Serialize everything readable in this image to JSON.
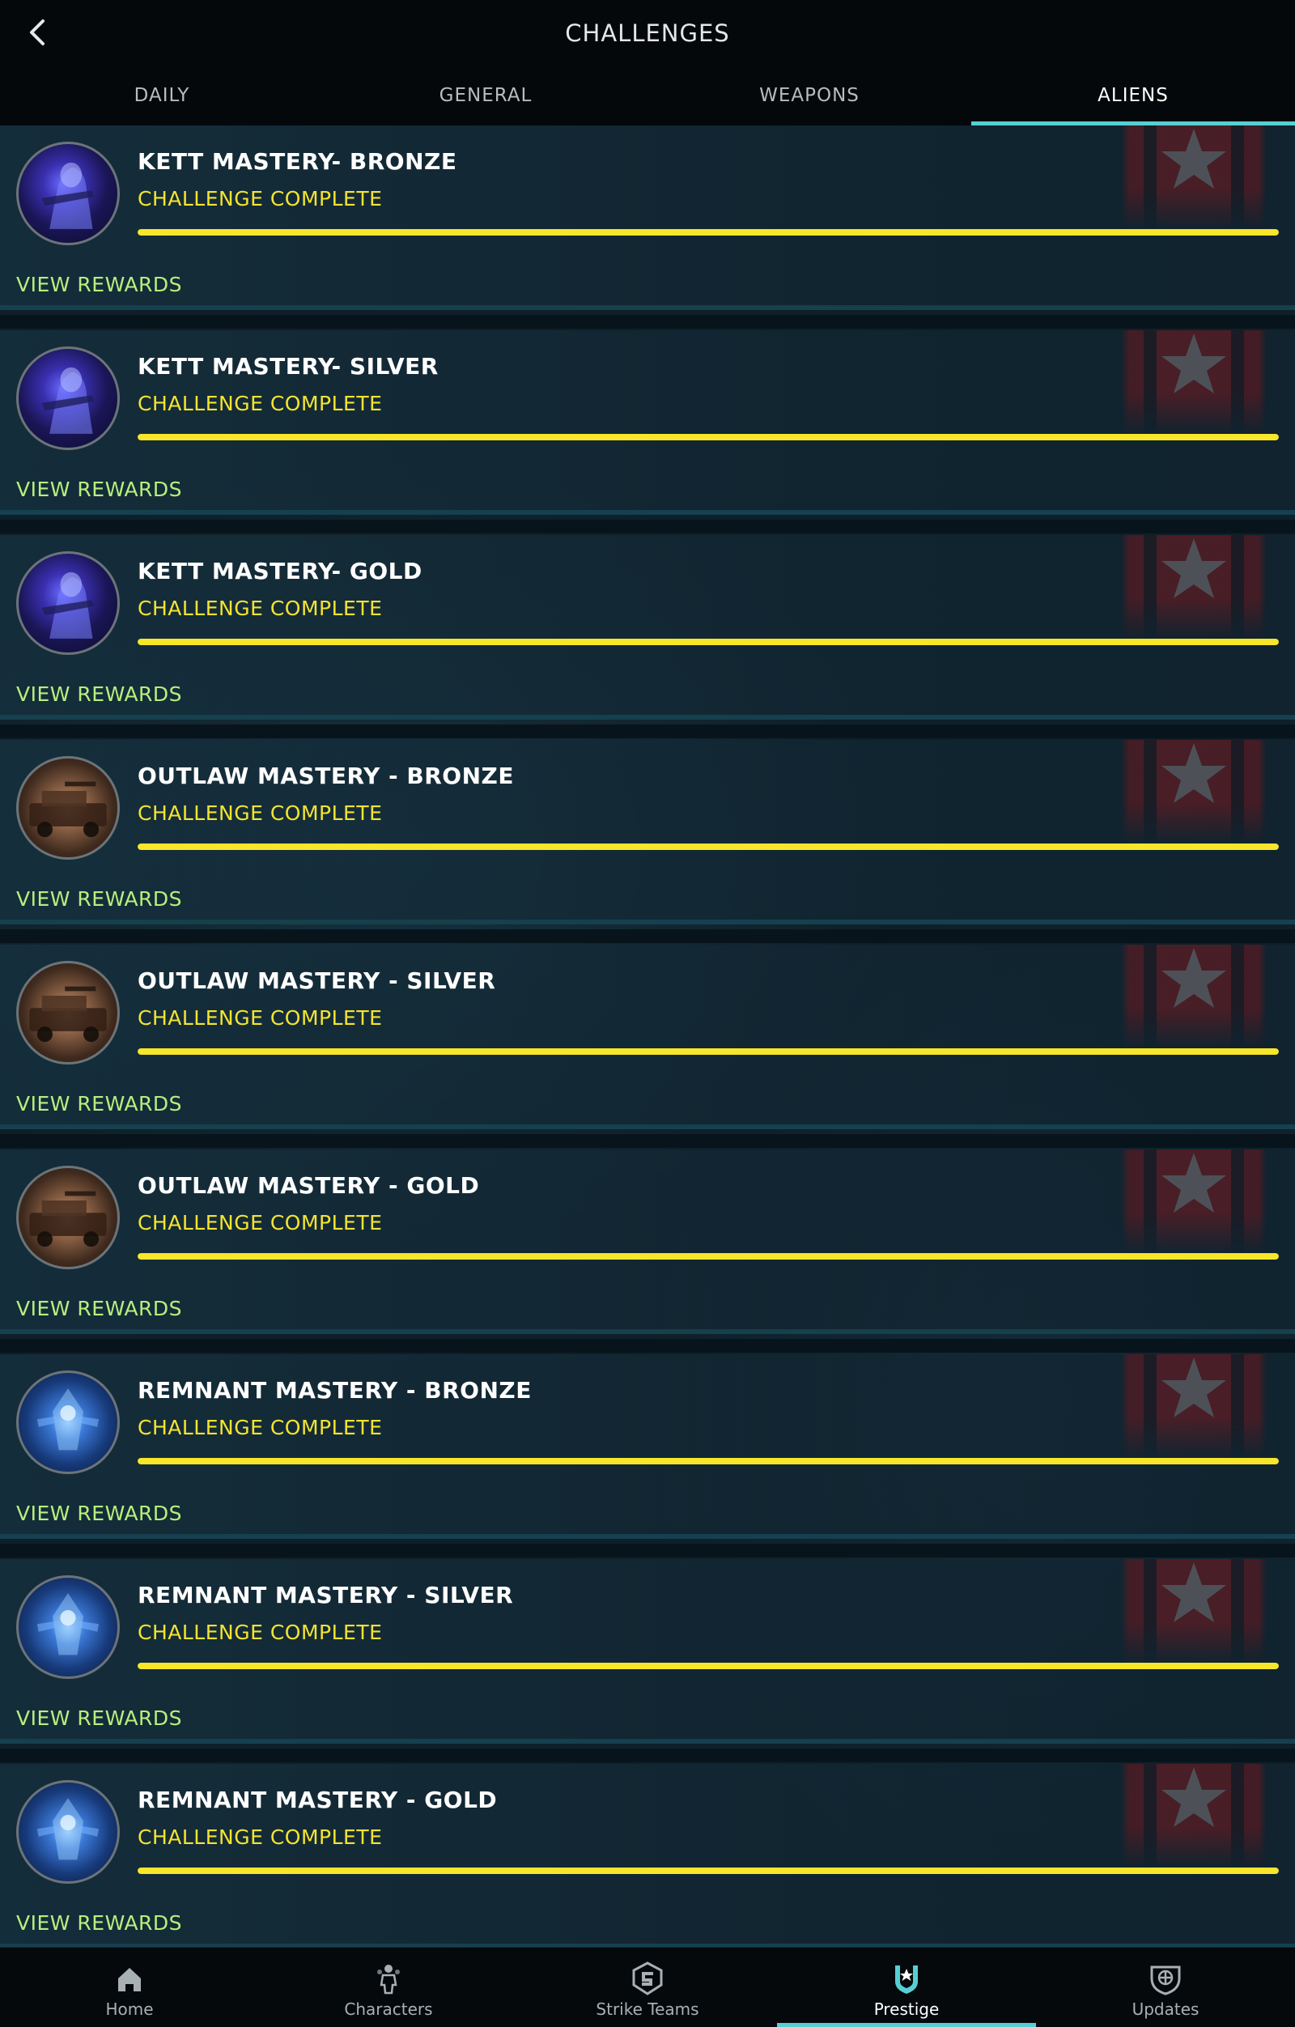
{
  "header": {
    "title": "CHALLENGES",
    "back_icon": "chevron-left-icon"
  },
  "tabs": [
    {
      "label": "DAILY",
      "active": false
    },
    {
      "label": "GENERAL",
      "active": false
    },
    {
      "label": "WEAPONS",
      "active": false
    },
    {
      "label": "ALIENS",
      "active": true
    }
  ],
  "challenges": [
    {
      "title": "KETT MASTERY- BRONZE",
      "status": "CHALLENGE COMPLETE",
      "progress": 1.0,
      "rewards_label": "VIEW REWARDS",
      "icon": "kett"
    },
    {
      "title": "KETT MASTERY- SILVER",
      "status": "CHALLENGE COMPLETE",
      "progress": 1.0,
      "rewards_label": "VIEW REWARDS",
      "icon": "kett"
    },
    {
      "title": "KETT MASTERY- GOLD",
      "status": "CHALLENGE COMPLETE",
      "progress": 1.0,
      "rewards_label": "VIEW REWARDS",
      "icon": "kett"
    },
    {
      "title": "OUTLAW MASTERY - BRONZE",
      "status": "CHALLENGE COMPLETE",
      "progress": 1.0,
      "rewards_label": "VIEW REWARDS",
      "icon": "outlaw"
    },
    {
      "title": "OUTLAW MASTERY - SILVER",
      "status": "CHALLENGE COMPLETE",
      "progress": 1.0,
      "rewards_label": "VIEW REWARDS",
      "icon": "outlaw"
    },
    {
      "title": "OUTLAW MASTERY - GOLD",
      "status": "CHALLENGE COMPLETE",
      "progress": 1.0,
      "rewards_label": "VIEW REWARDS",
      "icon": "outlaw"
    },
    {
      "title": "REMNANT MASTERY - BRONZE",
      "status": "CHALLENGE COMPLETE",
      "progress": 1.0,
      "rewards_label": "VIEW REWARDS",
      "icon": "remnant"
    },
    {
      "title": "REMNANT MASTERY - SILVER",
      "status": "CHALLENGE COMPLETE",
      "progress": 1.0,
      "rewards_label": "VIEW REWARDS",
      "icon": "remnant"
    },
    {
      "title": "REMNANT MASTERY - GOLD",
      "status": "CHALLENGE COMPLETE",
      "progress": 1.0,
      "rewards_label": "VIEW REWARDS",
      "icon": "remnant"
    }
  ],
  "colors": {
    "accent": "#56cfd3",
    "status": "#f3e431",
    "progress": "#f7e62a",
    "rewards": "#b7ef7e"
  },
  "bottom_nav": [
    {
      "label": "Home",
      "icon": "home-icon",
      "active": false
    },
    {
      "label": "Characters",
      "icon": "characters-icon",
      "active": false
    },
    {
      "label": "Strike Teams",
      "icon": "strike-teams-icon",
      "active": false
    },
    {
      "label": "Prestige",
      "icon": "prestige-icon",
      "active": true
    },
    {
      "label": "Updates",
      "icon": "updates-icon",
      "active": false
    }
  ]
}
